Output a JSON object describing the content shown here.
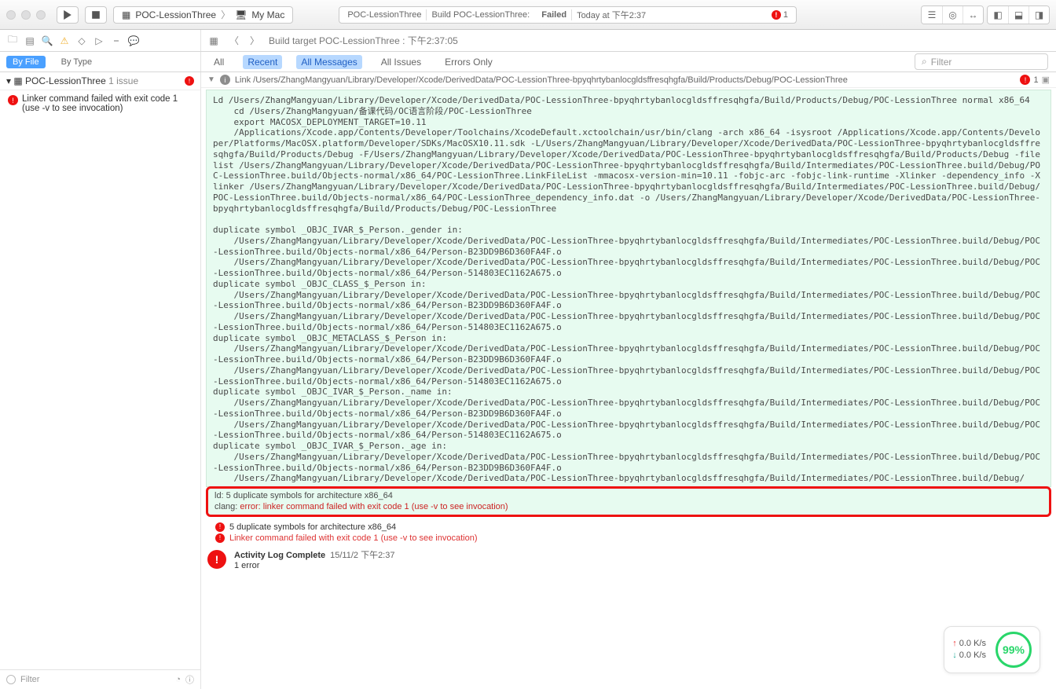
{
  "titlebar": {
    "scheme_target": "POC-LessionThree",
    "scheme_device": "My Mac",
    "activity_left": "POC-LessionThree",
    "activity_mid": "Build POC-LessionThree:",
    "activity_status": "Failed",
    "activity_time": "Today at 下午2:37",
    "err_count": "1"
  },
  "jumpbar": {
    "text": "Build target POC-LessionThree : 下午2:37:05"
  },
  "scope": {
    "byfile": "By File",
    "bytype": "By Type",
    "all": "All",
    "recent": "Recent",
    "allmsg": "All Messages",
    "allissues": "All Issues",
    "erronly": "Errors Only",
    "filter_ph": "Filter"
  },
  "nav": {
    "project": "POC-LessionThree",
    "issue_suffix": "1 issue",
    "item1": "Linker command failed with exit code 1 (use -v to see invocation)",
    "filter_ph": "Filter"
  },
  "linkrow": {
    "text": "Link /Users/ZhangMangyuan/Library/Developer/Xcode/DerivedData/POC-LessionThree-bpyqhrtybanlocgldsffresqhgfa/Build/Products/Debug/POC-LessionThree",
    "err_count": "1"
  },
  "log": "Ld /Users/ZhangMangyuan/Library/Developer/Xcode/DerivedData/POC-LessionThree-bpyqhrtybanlocgldsffresqhgfa/Build/Products/Debug/POC-LessionThree normal x86_64\n    cd /Users/ZhangMangyuan/备课代码/OC语言阶段/POC-LessionThree\n    export MACOSX_DEPLOYMENT_TARGET=10.11\n    /Applications/Xcode.app/Contents/Developer/Toolchains/XcodeDefault.xctoolchain/usr/bin/clang -arch x86_64 -isysroot /Applications/Xcode.app/Contents/Developer/Platforms/MacOSX.platform/Developer/SDKs/MacOSX10.11.sdk -L/Users/ZhangMangyuan/Library/Developer/Xcode/DerivedData/POC-LessionThree-bpyqhrtybanlocgldsffresqhgfa/Build/Products/Debug -F/Users/ZhangMangyuan/Library/Developer/Xcode/DerivedData/POC-LessionThree-bpyqhrtybanlocgldsffresqhgfa/Build/Products/Debug -filelist /Users/ZhangMangyuan/Library/Developer/Xcode/DerivedData/POC-LessionThree-bpyqhrtybanlocgldsffresqhgfa/Build/Intermediates/POC-LessionThree.build/Debug/POC-LessionThree.build/Objects-normal/x86_64/POC-LessionThree.LinkFileList -mmacosx-version-min=10.11 -fobjc-arc -fobjc-link-runtime -Xlinker -dependency_info -Xlinker /Users/ZhangMangyuan/Library/Developer/Xcode/DerivedData/POC-LessionThree-bpyqhrtybanlocgldsffresqhgfa/Build/Intermediates/POC-LessionThree.build/Debug/POC-LessionThree.build/Objects-normal/x86_64/POC-LessionThree_dependency_info.dat -o /Users/ZhangMangyuan/Library/Developer/Xcode/DerivedData/POC-LessionThree-bpyqhrtybanlocgldsffresqhgfa/Build/Products/Debug/POC-LessionThree\n\nduplicate symbol _OBJC_IVAR_$_Person._gender in:\n    /Users/ZhangMangyuan/Library/Developer/Xcode/DerivedData/POC-LessionThree-bpyqhrtybanlocgldsffresqhgfa/Build/Intermediates/POC-LessionThree.build/Debug/POC-LessionThree.build/Objects-normal/x86_64/Person-B23DD9B6D360FA4F.o\n    /Users/ZhangMangyuan/Library/Developer/Xcode/DerivedData/POC-LessionThree-bpyqhrtybanlocgldsffresqhgfa/Build/Intermediates/POC-LessionThree.build/Debug/POC-LessionThree.build/Objects-normal/x86_64/Person-514803EC1162A675.o\nduplicate symbol _OBJC_CLASS_$_Person in:\n    /Users/ZhangMangyuan/Library/Developer/Xcode/DerivedData/POC-LessionThree-bpyqhrtybanlocgldsffresqhgfa/Build/Intermediates/POC-LessionThree.build/Debug/POC-LessionThree.build/Objects-normal/x86_64/Person-B23DD9B6D360FA4F.o\n    /Users/ZhangMangyuan/Library/Developer/Xcode/DerivedData/POC-LessionThree-bpyqhrtybanlocgldsffresqhgfa/Build/Intermediates/POC-LessionThree.build/Debug/POC-LessionThree.build/Objects-normal/x86_64/Person-514803EC1162A675.o\nduplicate symbol _OBJC_METACLASS_$_Person in:\n    /Users/ZhangMangyuan/Library/Developer/Xcode/DerivedData/POC-LessionThree-bpyqhrtybanlocgldsffresqhgfa/Build/Intermediates/POC-LessionThree.build/Debug/POC-LessionThree.build/Objects-normal/x86_64/Person-B23DD9B6D360FA4F.o\n    /Users/ZhangMangyuan/Library/Developer/Xcode/DerivedData/POC-LessionThree-bpyqhrtybanlocgldsffresqhgfa/Build/Intermediates/POC-LessionThree.build/Debug/POC-LessionThree.build/Objects-normal/x86_64/Person-514803EC1162A675.o\nduplicate symbol _OBJC_IVAR_$_Person._name in:\n    /Users/ZhangMangyuan/Library/Developer/Xcode/DerivedData/POC-LessionThree-bpyqhrtybanlocgldsffresqhgfa/Build/Intermediates/POC-LessionThree.build/Debug/POC-LessionThree.build/Objects-normal/x86_64/Person-B23DD9B6D360FA4F.o\n    /Users/ZhangMangyuan/Library/Developer/Xcode/DerivedData/POC-LessionThree-bpyqhrtybanlocgldsffresqhgfa/Build/Intermediates/POC-LessionThree.build/Debug/POC-LessionThree.build/Objects-normal/x86_64/Person-514803EC1162A675.o\nduplicate symbol _OBJC_IVAR_$_Person._age in:\n    /Users/ZhangMangyuan/Library/Developer/Xcode/DerivedData/POC-LessionThree-bpyqhrtybanlocgldsffresqhgfa/Build/Intermediates/POC-LessionThree.build/Debug/POC-LessionThree.build/Objects-normal/x86_64/Person-B23DD9B6D360FA4F.o\n    /Users/ZhangMangyuan/Library/Developer/Xcode/DerivedData/POC-LessionThree-bpyqhrtybanlocgldsffresqhgfa/Build/Intermediates/POC-LessionThree.build/Debug/",
  "redbox": {
    "l1": "ld: 5 duplicate symbols for architecture x86_64",
    "l2a": "clang: ",
    "l2b": "error: ",
    "l2c": "linker command failed with exit code 1 (use -v to see invocation)"
  },
  "summary": {
    "s1": "5 duplicate symbols for architecture x86_64",
    "s2": "Linker command failed with exit code 1 (use -v to see invocation)",
    "act_title": "Activity Log Complete",
    "act_ts": "15/11/2 下午2:37",
    "act_sub": "1 error"
  },
  "net": {
    "up": "0.0 K/s",
    "dn": "0.0 K/s",
    "pct": "99%"
  }
}
